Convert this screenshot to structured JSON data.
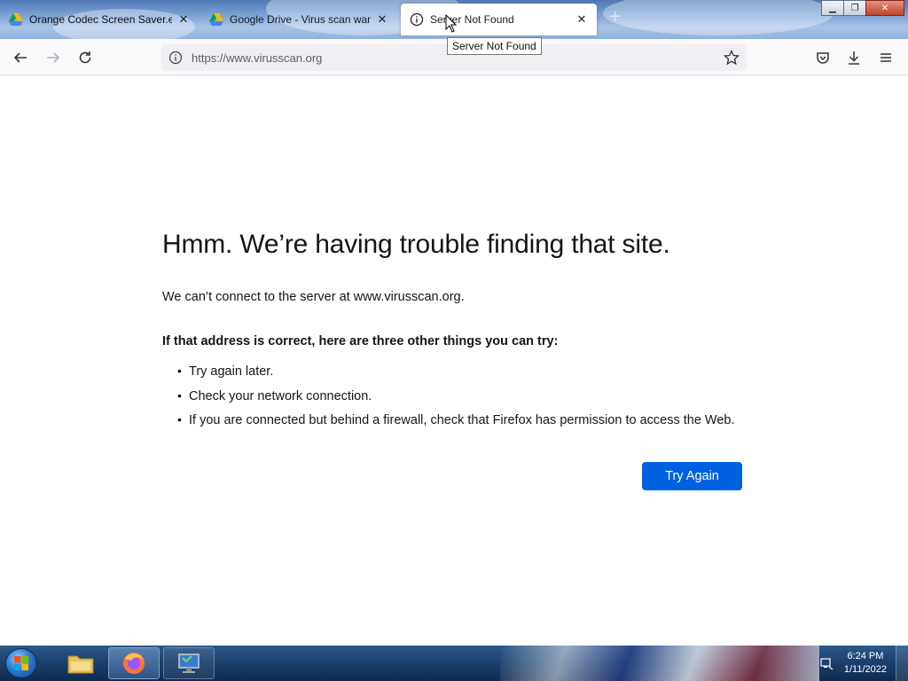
{
  "tabs": [
    {
      "title": "Orange Codec Screen Saver.exe",
      "icon": "google-drive-icon"
    },
    {
      "title": "Google Drive - Virus scan warning",
      "icon": "google-drive-icon"
    },
    {
      "title": "Server Not Found",
      "icon": "info-icon",
      "active": true
    }
  ],
  "tooltip": "Server Not Found",
  "window": {
    "minimize": "▁",
    "restore": "❐",
    "close": "✕"
  },
  "urlbar": {
    "url": "https://www.virusscan.org"
  },
  "error": {
    "title": "Hmm. We’re having trouble finding that site.",
    "description": "We can’t connect to the server at www.virusscan.org.",
    "heading": "If that address is correct, here are three other things you can try:",
    "suggestions": [
      "Try again later.",
      "Check your network connection.",
      "If you are connected but behind a firewall, check that Firefox has permission to access the Web."
    ],
    "button": "Try Again"
  },
  "taskbar": {
    "time": "6:24 PM",
    "date": "1/11/2022"
  },
  "colors": {
    "accent": "#0061e0",
    "text": "#15141a"
  }
}
